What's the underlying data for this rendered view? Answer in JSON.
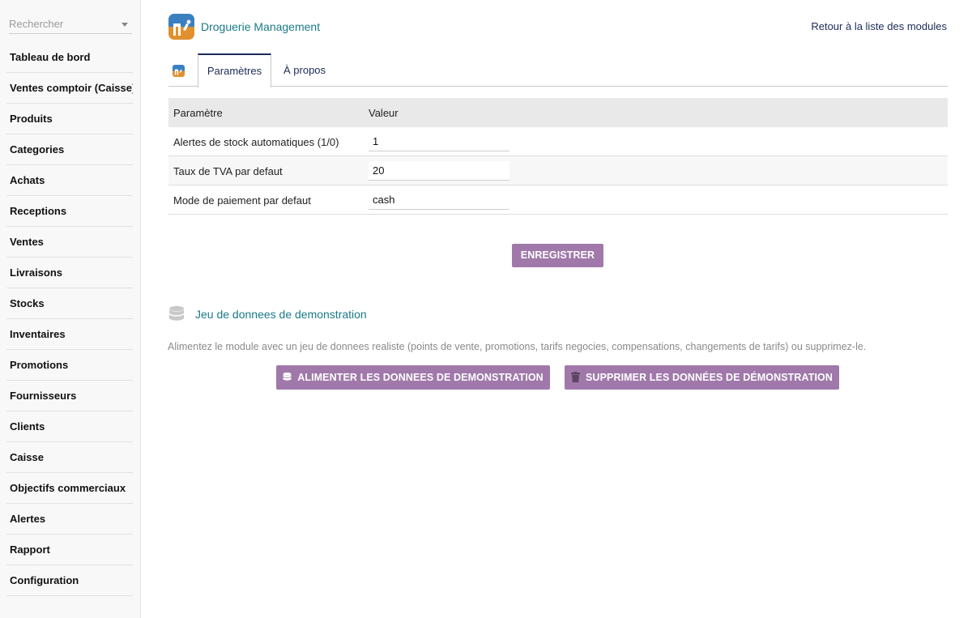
{
  "sidebar": {
    "search_placeholder": "Rechercher",
    "items": [
      {
        "label": "Tableau de bord"
      },
      {
        "label": "Ventes comptoir (Caisse)"
      },
      {
        "label": "Produits"
      },
      {
        "label": "Categories"
      },
      {
        "label": "Achats"
      },
      {
        "label": "Receptions"
      },
      {
        "label": "Ventes"
      },
      {
        "label": "Livraisons"
      },
      {
        "label": "Stocks"
      },
      {
        "label": "Inventaires"
      },
      {
        "label": "Promotions"
      },
      {
        "label": "Fournisseurs"
      },
      {
        "label": "Clients"
      },
      {
        "label": "Caisse"
      },
      {
        "label": "Objectifs commerciaux"
      },
      {
        "label": "Alertes"
      },
      {
        "label": "Rapport"
      },
      {
        "label": "Configuration"
      }
    ]
  },
  "header": {
    "title": "Droguerie Management",
    "back_link": "Retour à la liste des modules"
  },
  "tabs": [
    {
      "label": "Paramètres",
      "active": true
    },
    {
      "label": "À propos",
      "active": false
    }
  ],
  "params_table": {
    "headers": [
      "Paramètre",
      "Valeur"
    ],
    "rows": [
      {
        "label": "Alertes de stock automatiques (1/0)",
        "value": "1"
      },
      {
        "label": "Taux de TVA par defaut",
        "value": "20"
      },
      {
        "label": "Mode de paiement par defaut",
        "value": "cash"
      }
    ]
  },
  "save_button": "ENREGISTRER",
  "demo": {
    "title": "Jeu de donnees de demonstration",
    "description": "Alimentez le module avec un jeu de donnees realiste (points de vente, promotions, tarifs negocies, compensations, changements de tarifs) ou supprimez-le.",
    "feed_button": "ALIMENTER LES DONNEES DE DEMONSTRATION",
    "delete_button": "SUPPRIMER LES DONNÉES DE DÉMONSTRATION"
  },
  "colors": {
    "accent_title": "#1a7a86",
    "link": "#1c2b5a",
    "button": "#a078aa"
  },
  "icons": {
    "app_logo": "app-logo-icon",
    "search_caret": "chevron-down-icon",
    "demo_section": "database-icon",
    "feed_button": "database-icon",
    "delete_button": "trash-icon"
  }
}
